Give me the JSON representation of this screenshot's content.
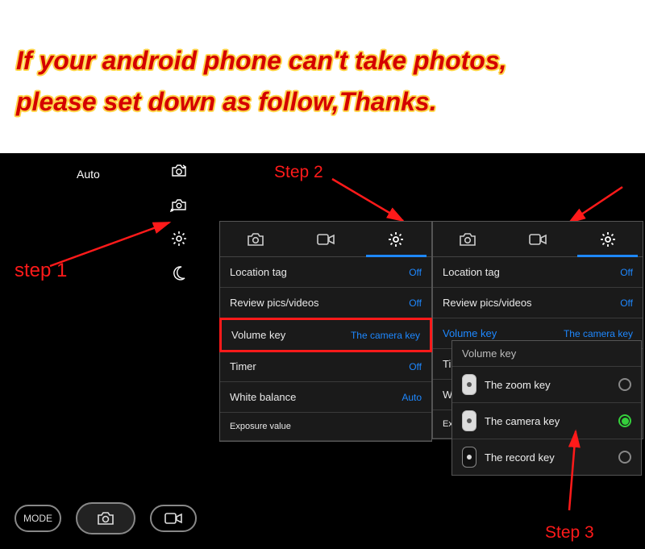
{
  "instruction_line1": "If your android phone can't take photos,",
  "instruction_line2": "please set down as follow,Thanks.",
  "steps": {
    "s1": "step 1",
    "s2": "Step 2",
    "s3": "Step 3"
  },
  "camera": {
    "auto": "Auto",
    "mode": "MODE"
  },
  "settings": {
    "rows": [
      {
        "label": "Location tag",
        "value": "Off"
      },
      {
        "label": "Review pics/videos",
        "value": "Off"
      },
      {
        "label": "Volume key",
        "value": "The camera key"
      },
      {
        "label": "Timer",
        "value": "Off"
      },
      {
        "label": "White balance",
        "value": "Auto"
      },
      {
        "label": "Exposure value",
        "value": ""
      }
    ],
    "truncated": {
      "timer": "Timer",
      "white": "White",
      "expos": "Expos"
    }
  },
  "popup": {
    "title": "Volume key",
    "options": [
      {
        "label": "The zoom key",
        "selected": false
      },
      {
        "label": "The camera key",
        "selected": true
      },
      {
        "label": "The record key",
        "selected": false
      }
    ]
  }
}
